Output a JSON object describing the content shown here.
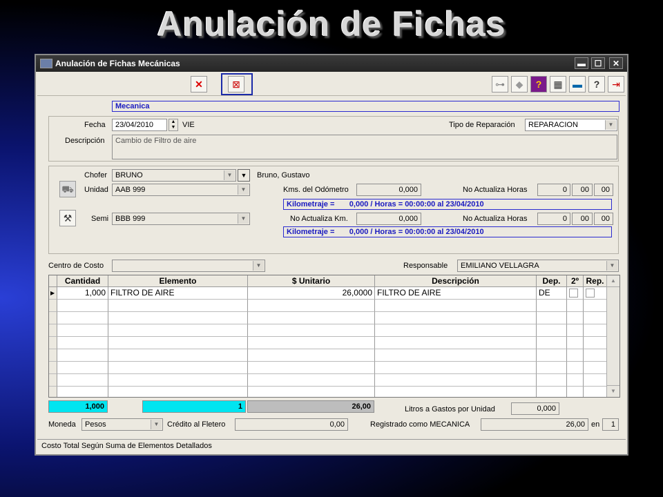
{
  "slide_title": "Anulación de Fichas",
  "window": {
    "title": "Anulación de Fichas Mecánicas",
    "minimize_glyph": "▬",
    "maximize_glyph": "☐",
    "close_glyph": "✕"
  },
  "toolbar": {
    "left_icons": [
      "delete-x-icon",
      "cancel-record-icon"
    ],
    "right_icons": [
      "binoculars-icon",
      "tag-icon",
      "help-purple-icon",
      "calculator-icon",
      "display-icon",
      "question-icon",
      "exit-door-icon"
    ],
    "highlight_color": "#1a2aa8"
  },
  "header": {
    "type_value": "Mecanica",
    "fecha_label": "Fecha",
    "fecha_value": "23/04/2010",
    "day_value": "VIE",
    "tipo_label": "Tipo de Reparación",
    "tipo_value": "REPARACION",
    "descripcion_label": "Descripción",
    "descripcion_value": "Cambio de Filtro de aire"
  },
  "vehicle": {
    "chofer_label": "Chofer",
    "chofer_value": "BRUNO",
    "chofer_name": "Bruno, Gustavo",
    "unidad_label": "Unidad",
    "unidad_value": "AAB 999",
    "kms_label": "Kms. del Odómetro",
    "kms_value": "0,000",
    "no_act_horas_label_1": "No Actualiza Horas",
    "horas_1": [
      "0",
      "00",
      "00"
    ],
    "kilometraje_1": "Kilometraje =       0,000 / Horas = 00:00:00 al 23/04/2010",
    "semi_label": "Semi",
    "semi_value": "BBB 999",
    "no_act_km_label": "No Actualiza Km.",
    "km_value_2": "0,000",
    "no_act_horas_label_2": "No Actualiza Horas",
    "horas_2": [
      "0",
      "00",
      "00"
    ],
    "kilometraje_2": "Kilometraje =       0,000 / Horas = 00:00:00 al 23/04/2010"
  },
  "cost": {
    "centro_label": "Centro de Costo",
    "centro_value": "",
    "responsable_label": "Responsable",
    "responsable_value": "EMILIANO VELLAGRA"
  },
  "grid": {
    "headers": [
      "Cantidad",
      "Elemento",
      "$ Unitario",
      "Descripción",
      "Dep.",
      "2º",
      "Rep."
    ],
    "rows": [
      {
        "cantidad": "1,000",
        "elemento": "FILTRO DE AIRE",
        "unitario": "26,0000",
        "descripcion": "FILTRO DE AIRE",
        "dep": "DE"
      }
    ]
  },
  "totals": {
    "cantidad_total": "1,000",
    "count_total": "1",
    "amount_total": "26,00",
    "litros_label": "Litros a Gastos por Unidad",
    "litros_value": "0,000",
    "cyan_color": "#00e5f0"
  },
  "footer": {
    "moneda_label": "Moneda",
    "moneda_value": "Pesos",
    "credito_label": "Crédito al Fletero",
    "credito_value": "0,00",
    "registrado_label": "Registrado como MECANICA",
    "registrado_value": "26,00",
    "en_label": "en",
    "en_value": "1"
  },
  "status_text": "Costo Total Según Suma de Elementos Detallados"
}
